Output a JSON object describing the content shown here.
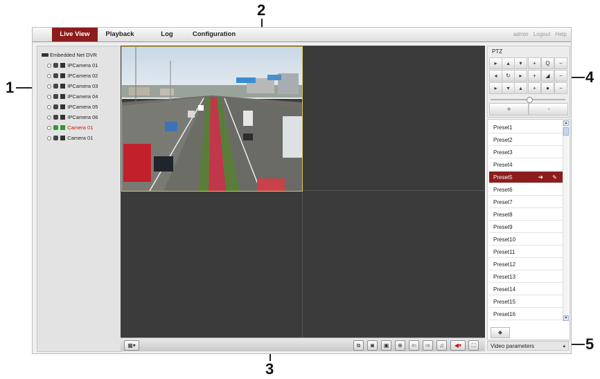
{
  "callouts": {
    "n1": "1",
    "n2": "2",
    "n3": "3",
    "n4": "4",
    "n5": "5"
  },
  "nav": {
    "tabs": [
      {
        "label": "Live View",
        "active": true
      },
      {
        "label": "Playback",
        "active": false
      },
      {
        "label": "Log",
        "active": false
      },
      {
        "label": "Configuration",
        "active": false
      }
    ],
    "user": "admin",
    "logout": "Logout",
    "help": "Help"
  },
  "tree": {
    "root": "Embedded Net DVR",
    "items": [
      {
        "label": "IPCamera 01",
        "active": false
      },
      {
        "label": "IPCamera 02",
        "active": false
      },
      {
        "label": "IPCamera 03",
        "active": false
      },
      {
        "label": "IPCamera 04",
        "active": false
      },
      {
        "label": "IPCamera 05",
        "active": false
      },
      {
        "label": "IPCamera 06",
        "active": false
      },
      {
        "label": "Camera 01",
        "active": true
      },
      {
        "label": "Camera 01",
        "active": false
      }
    ]
  },
  "ptz": {
    "title": "PTZ"
  },
  "presets": {
    "items": [
      "Preset1",
      "Preset2",
      "Preset3",
      "Preset4",
      "Preset5",
      "Preset6",
      "Preset7",
      "Preset8",
      "Preset9",
      "Preset10",
      "Preset11",
      "Preset12",
      "Preset13",
      "Preset14",
      "Preset15",
      "Preset16"
    ],
    "selected": "Preset5"
  },
  "video_params": {
    "label": "Video parameters"
  },
  "colors": {
    "accent": "#8d1c1c",
    "active_camera": "#d81010",
    "video_bg": "#3b3b3b"
  }
}
